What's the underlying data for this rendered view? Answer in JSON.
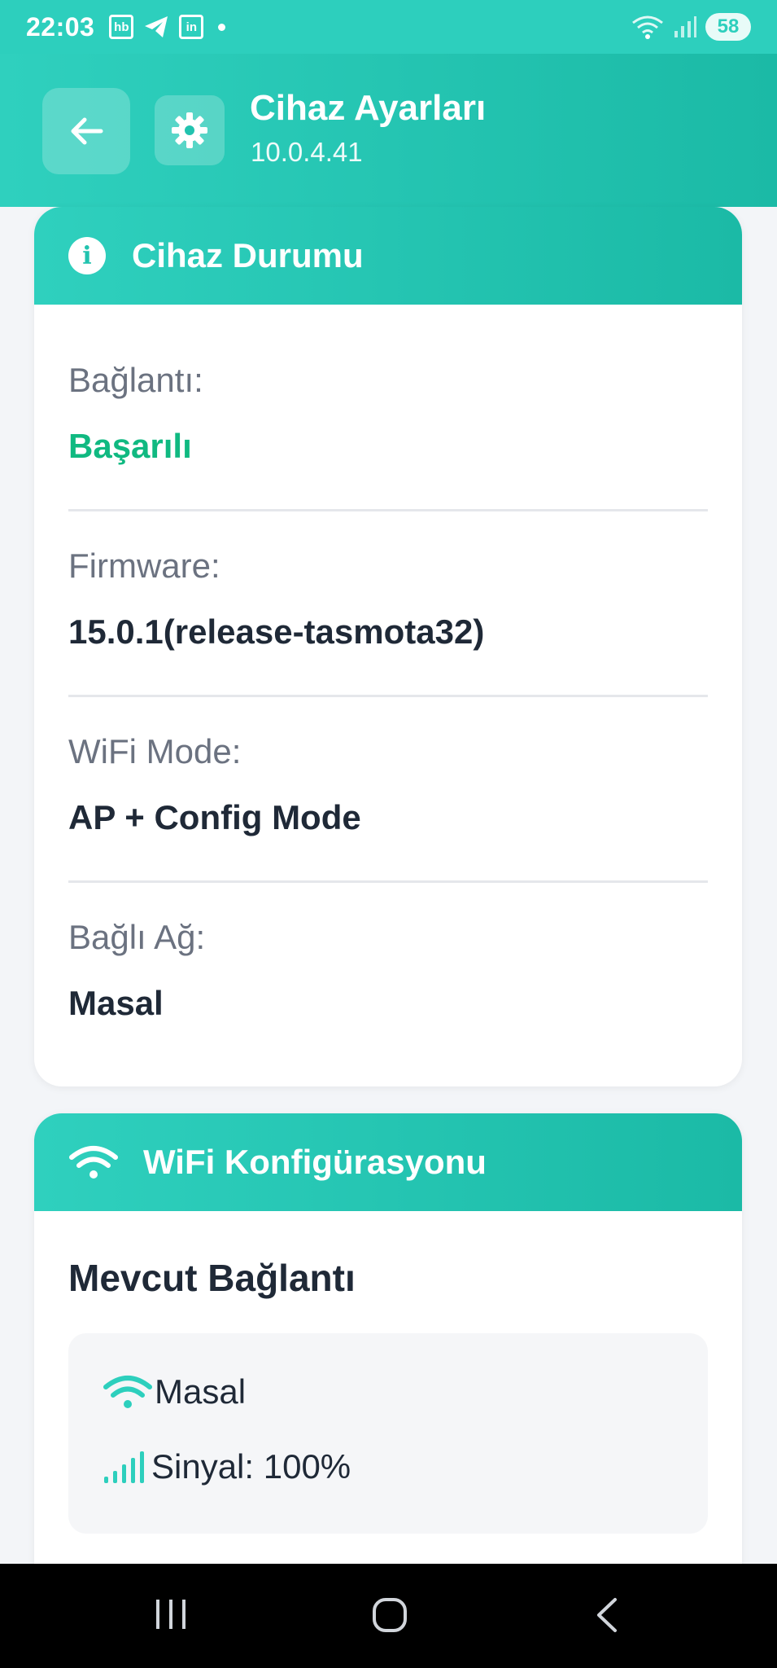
{
  "status_bar": {
    "time": "22:03",
    "left_icons": [
      "hb-app-icon",
      "telegram-icon",
      "linkedin-icon",
      "dot-icon"
    ],
    "hb_label": "hb",
    "linkedin_label": "in",
    "right_icons": [
      "wifi-6-icon",
      "cell-signal-icon"
    ],
    "battery": "58"
  },
  "header": {
    "title": "Cihaz Ayarları",
    "subtitle": "10.0.4.41",
    "back_icon": "arrow-left-icon",
    "settings_icon": "gear-icon"
  },
  "device_status": {
    "title": "Cihaz Durumu",
    "icon": "info-icon",
    "rows": [
      {
        "label": "Bağlantı:",
        "value": "Başarılı"
      },
      {
        "label": "Firmware:",
        "value": "15.0.1(release-tasmota32)"
      },
      {
        "label": "WiFi Mode:",
        "value": "AP + Config Mode"
      },
      {
        "label": "Bağlı Ağ:",
        "value": "Masal"
      }
    ]
  },
  "wifi_config": {
    "title": "WiFi Konfigürasyonu",
    "icon": "wifi-icon",
    "current_title": "Mevcut Bağlantı",
    "network_name": "Masal",
    "signal_text": "Sinyal: 100%",
    "signal_percent": 100
  },
  "nav": {
    "items": [
      "recent-apps-icon",
      "home-icon",
      "back-icon"
    ]
  },
  "colors": {
    "teal": "#2dcfbd",
    "teal_dark": "#1bbaa6",
    "success": "#10b981",
    "label_gray": "#6b7280"
  }
}
